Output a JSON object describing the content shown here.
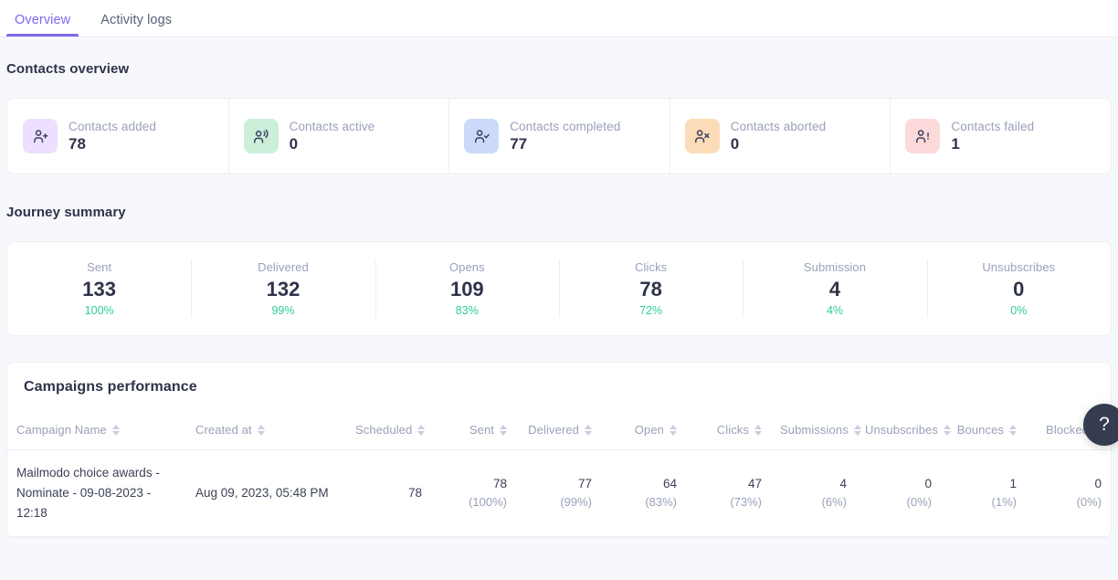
{
  "tabs": [
    {
      "id": "overview",
      "label": "Overview",
      "active": true
    },
    {
      "id": "activity-logs",
      "label": "Activity logs",
      "active": false
    }
  ],
  "contacts_overview": {
    "title": "Contacts overview",
    "cards": [
      {
        "icon": "user-plus-icon",
        "label": "Contacts added",
        "value": "78",
        "bg": "#ecdfff",
        "fg": "#3b4163"
      },
      {
        "icon": "user-active-icon",
        "label": "Contacts active",
        "value": "0",
        "bg": "#ccefda",
        "fg": "#3b4163"
      },
      {
        "icon": "user-check-icon",
        "label": "Contacts completed",
        "value": "77",
        "bg": "#ccd9fb",
        "fg": "#3b4163"
      },
      {
        "icon": "user-x-icon",
        "label": "Contacts aborted",
        "value": "0",
        "bg": "#fcdcb8",
        "fg": "#3b4163"
      },
      {
        "icon": "user-alert-icon",
        "label": "Contacts failed",
        "value": "1",
        "bg": "#fcd9da",
        "fg": "#3b4163"
      }
    ]
  },
  "journey_summary": {
    "title": "Journey summary",
    "metrics": [
      {
        "label": "Sent",
        "value": "133",
        "percent": "100%"
      },
      {
        "label": "Delivered",
        "value": "132",
        "percent": "99%"
      },
      {
        "label": "Opens",
        "value": "109",
        "percent": "83%"
      },
      {
        "label": "Clicks",
        "value": "78",
        "percent": "72%"
      },
      {
        "label": "Submission",
        "value": "4",
        "percent": "4%"
      },
      {
        "label": "Unsubscribes",
        "value": "0",
        "percent": "0%"
      }
    ]
  },
  "campaigns_performance": {
    "title": "Campaigns performance",
    "columns": [
      {
        "label": "Campaign Name",
        "sortable": true,
        "align": "left"
      },
      {
        "label": "Created at",
        "sortable": true,
        "align": "left"
      },
      {
        "label": "Scheduled",
        "sortable": true,
        "align": "right"
      },
      {
        "label": "Sent",
        "sortable": true,
        "align": "right"
      },
      {
        "label": "Delivered",
        "sortable": true,
        "align": "right"
      },
      {
        "label": "Open",
        "sortable": true,
        "align": "right"
      },
      {
        "label": "Clicks",
        "sortable": true,
        "align": "right"
      },
      {
        "label": "Submissions",
        "sortable": true,
        "align": "right"
      },
      {
        "label": "Unsubscribes",
        "sortable": true,
        "align": "right"
      },
      {
        "label": "Bounces",
        "sortable": true,
        "align": "right"
      },
      {
        "label": "Blocked",
        "sortable": true,
        "align": "right"
      }
    ],
    "rows": [
      {
        "name": "Mailmodo choice awards - Nominate - 09-08-2023 - 12:18",
        "created_at": "Aug 09, 2023, 05:48 PM",
        "scheduled": "78",
        "sent": "78",
        "sent_pct": "(100%)",
        "delivered": "77",
        "delivered_pct": "(99%)",
        "open": "64",
        "open_pct": "(83%)",
        "clicks": "47",
        "clicks_pct": "(73%)",
        "submissions": "4",
        "submissions_pct": "(6%)",
        "unsubscribes": "0",
        "unsubscribes_pct": "(0%)",
        "bounces": "1",
        "bounces_pct": "(1%)",
        "blocked": "0",
        "blocked_pct": "(0%)"
      }
    ]
  },
  "help": {
    "icon": "question-mark-icon",
    "label": "?"
  },
  "colors": {
    "accent": "#7c68ee",
    "page_bg": "#f7f8fc",
    "card_bg": "#ffffff",
    "border": "#eceef4",
    "text_primary": "#2f3349",
    "text_muted": "#9aa1b9",
    "success_green": "#2ecc9b",
    "help_bg": "#353b50"
  }
}
